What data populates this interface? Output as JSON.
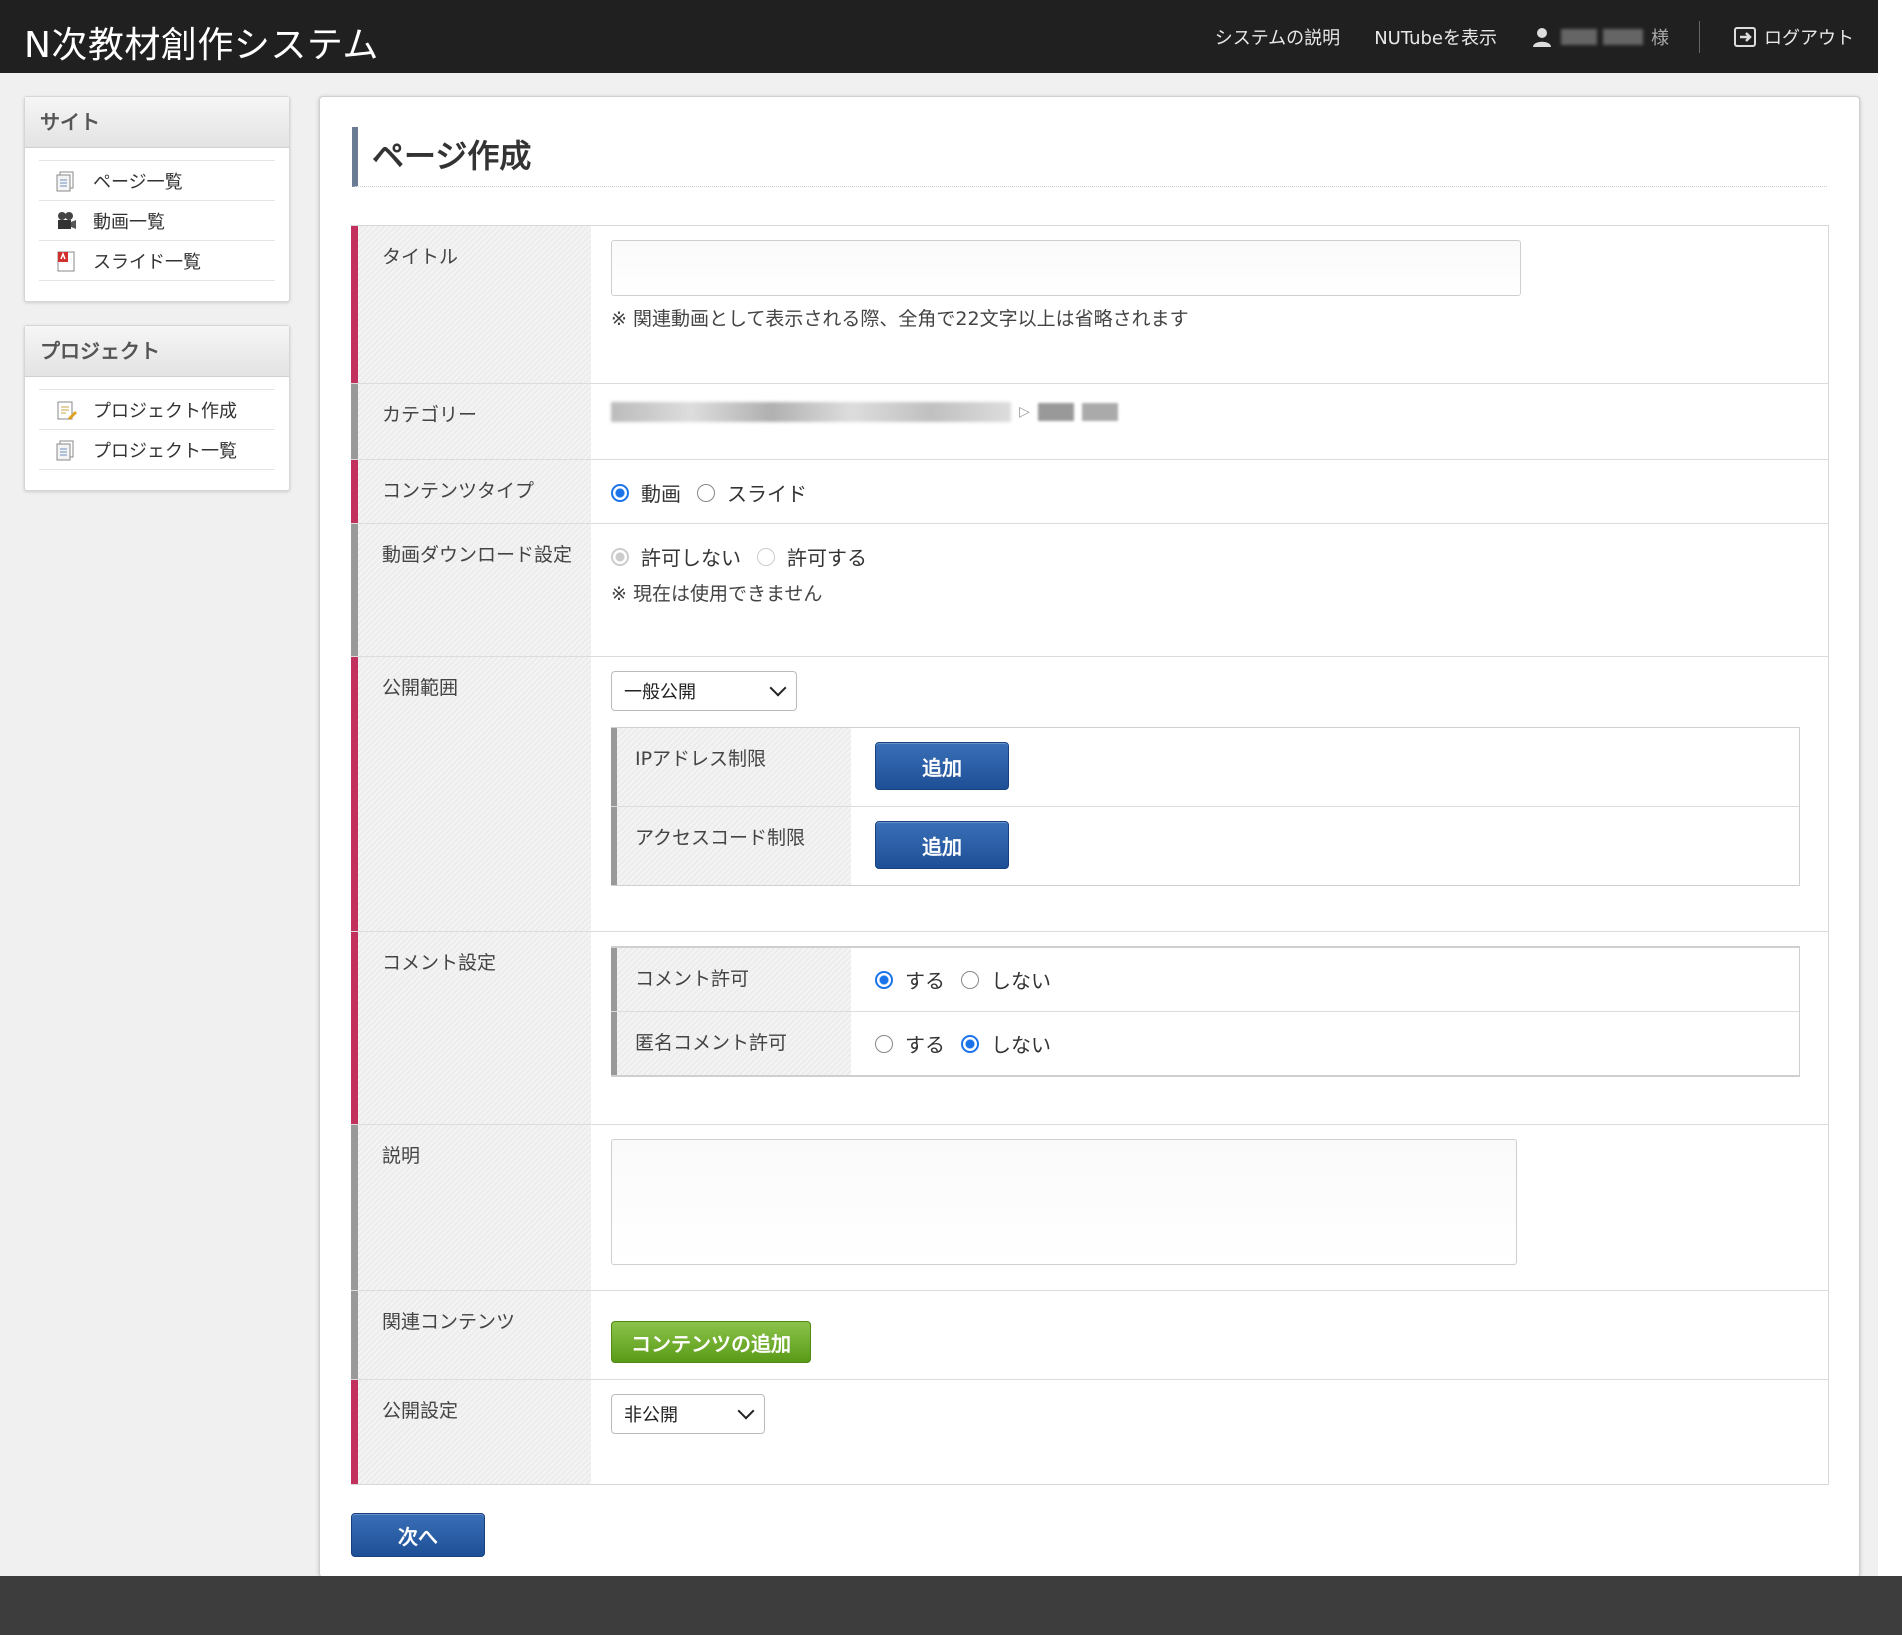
{
  "header": {
    "app_title": "N次教材創作システム",
    "nav_system_description": "システムの説明",
    "nav_show_nutube": "NUTubeを表示",
    "user_suffix": "様",
    "logout_label": "ログアウト"
  },
  "sidebar": {
    "site": {
      "title": "サイト",
      "items": [
        {
          "label": "ページ一覧",
          "icon": "page-list-icon"
        },
        {
          "label": "動画一覧",
          "icon": "video-camera-icon"
        },
        {
          "label": "スライド一覧",
          "icon": "pdf-icon"
        }
      ]
    },
    "project": {
      "title": "プロジェクト",
      "items": [
        {
          "label": "プロジェクト作成",
          "icon": "project-create-icon"
        },
        {
          "label": "プロジェクト一覧",
          "icon": "project-list-icon"
        }
      ]
    }
  },
  "page": {
    "title": "ページ作成"
  },
  "form": {
    "title": {
      "label": "タイトル",
      "value": "",
      "note": "※ 関連動画として表示される際、全角で22文字以上は省略されます"
    },
    "category": {
      "label": "カテゴリー"
    },
    "content_type": {
      "label": "コンテンツタイプ",
      "options": [
        "動画",
        "スライド"
      ],
      "selected": "動画"
    },
    "download": {
      "label": "動画ダウンロード設定",
      "options": [
        "許可しない",
        "許可する"
      ],
      "selected": "許可しない",
      "note": "※ 現在は使用できません"
    },
    "visibility": {
      "label": "公開範囲",
      "selected": "一般公開",
      "ip_label": "IPアドレス制限",
      "ip_button": "追加",
      "access_label": "アクセスコード制限",
      "access_button": "追加"
    },
    "comments": {
      "label": "コメント設定",
      "allow_label": "コメント許可",
      "allow_options": [
        "する",
        "しない"
      ],
      "allow_selected": "する",
      "anon_label": "匿名コメント許可",
      "anon_options": [
        "する",
        "しない"
      ],
      "anon_selected": "しない"
    },
    "description": {
      "label": "説明",
      "value": ""
    },
    "related": {
      "label": "関連コンテンツ",
      "button": "コンテンツの追加"
    },
    "publish": {
      "label": "公開設定",
      "selected": "非公開"
    }
  },
  "actions": {
    "next_label": "次へ"
  },
  "colors": {
    "header_bg": "#202020",
    "required_marker": "#c2315e",
    "optional_marker": "#999999",
    "primary_button": "#1d4f96",
    "green_button": "#5a9a18",
    "radio_selected": "#1a73e8"
  }
}
